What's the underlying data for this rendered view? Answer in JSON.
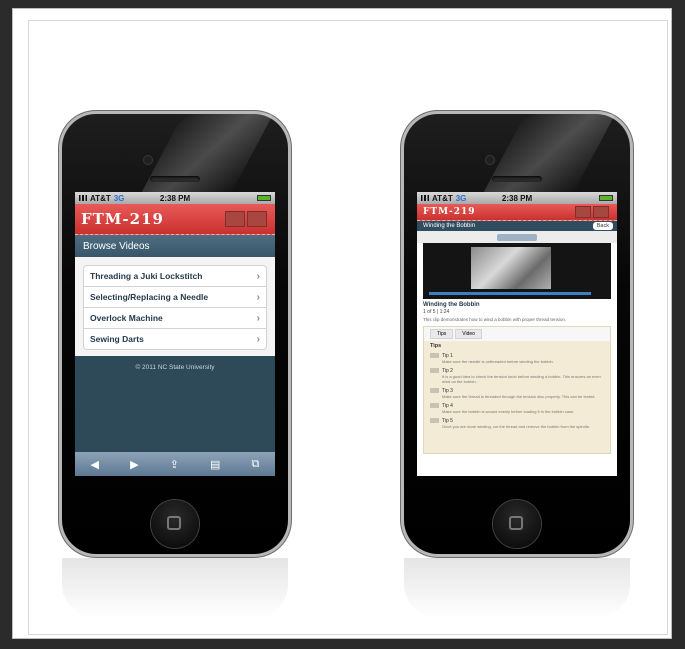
{
  "phone1": {
    "status": {
      "carrier": "AT&T",
      "network": "3G",
      "time": "2:38 PM"
    },
    "app_title": "FTM-219",
    "section_title": "Browse Videos",
    "videos": [
      {
        "label": "Threading a Juki Lockstitch"
      },
      {
        "label": "Selecting/Replacing a Needle"
      },
      {
        "label": "Overlock Machine"
      },
      {
        "label": "Sewing Darts"
      }
    ],
    "footer": "© 2011 NC State University",
    "toolbar_icons": [
      "back-icon",
      "forward-icon",
      "share-icon",
      "bookmarks-icon",
      "tabs-icon"
    ]
  },
  "phone2": {
    "status": {
      "carrier": "AT&T",
      "network": "3G",
      "time": "2:38 PM"
    },
    "app_title": "FTM-219",
    "nav_title": "Winding the Bobbin",
    "back_label": "Back",
    "video_title": "Winding the Bobbin",
    "video_meta": "1 of 5 | 1:24",
    "description": "This clip demonstrates how to wind a bobbin with proper thread tension.",
    "tabs": [
      "Tips",
      "Video"
    ],
    "tips_heading": "Tips",
    "tips": [
      {
        "label": "Tip 1",
        "text": "Make sure the needle is unthreaded before winding the bobbin."
      },
      {
        "label": "Tip 2",
        "text": "It is a good idea to check the tension knob before winding a bobbin. This ensures an even wind on the bobbin."
      },
      {
        "label": "Tip 3",
        "text": "Make sure the thread is threaded through the tension disc properly. This can be tested."
      },
      {
        "label": "Tip 4",
        "text": "Make sure the bobbin is wound evenly before loading it in the bobbin case."
      },
      {
        "label": "Tip 5",
        "text": "Once you are done winding, cut the thread and remove the bobbin from the spindle."
      }
    ]
  }
}
